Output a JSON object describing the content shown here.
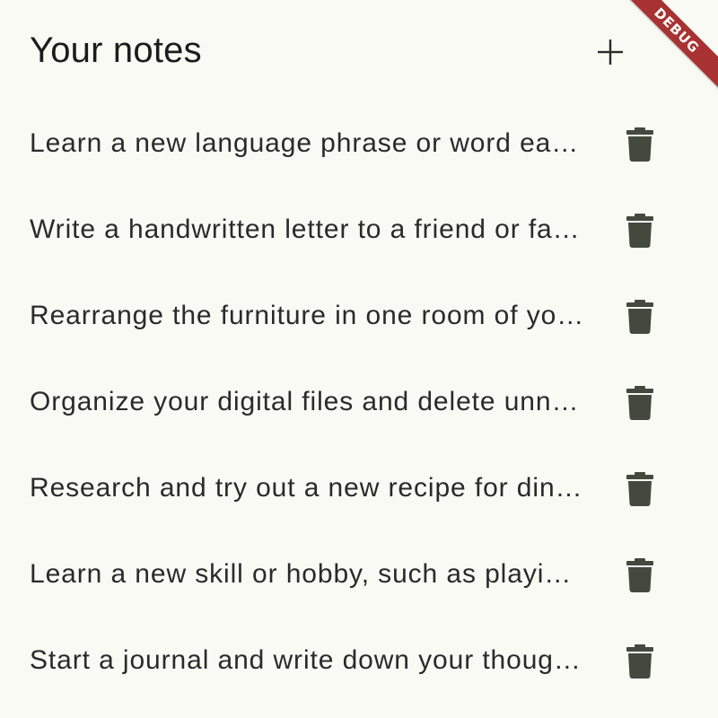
{
  "header": {
    "title": "Your notes",
    "add_icon": "plus-icon"
  },
  "notes": [
    {
      "text": "Learn a new language phrase or word each day",
      "icon": "trash-icon"
    },
    {
      "text": "Write a handwritten letter to a friend or family member",
      "icon": "trash-icon"
    },
    {
      "text": "Rearrange the furniture in one room of your home",
      "icon": "trash-icon"
    },
    {
      "text": "Organize your digital files and delete unnecessary ones",
      "icon": "trash-icon"
    },
    {
      "text": "Research and try out a new recipe for dinner",
      "icon": "trash-icon"
    },
    {
      "text": "Learn a new skill or hobby, such as playing an instrument",
      "icon": "trash-icon"
    },
    {
      "text": "Start a journal and write down your thoughts each day",
      "icon": "trash-icon"
    }
  ],
  "debug_banner": {
    "label": "DEBUG"
  },
  "colors": {
    "background": "#fafaf5",
    "icon": "#44483f",
    "banner": "#a83232"
  }
}
